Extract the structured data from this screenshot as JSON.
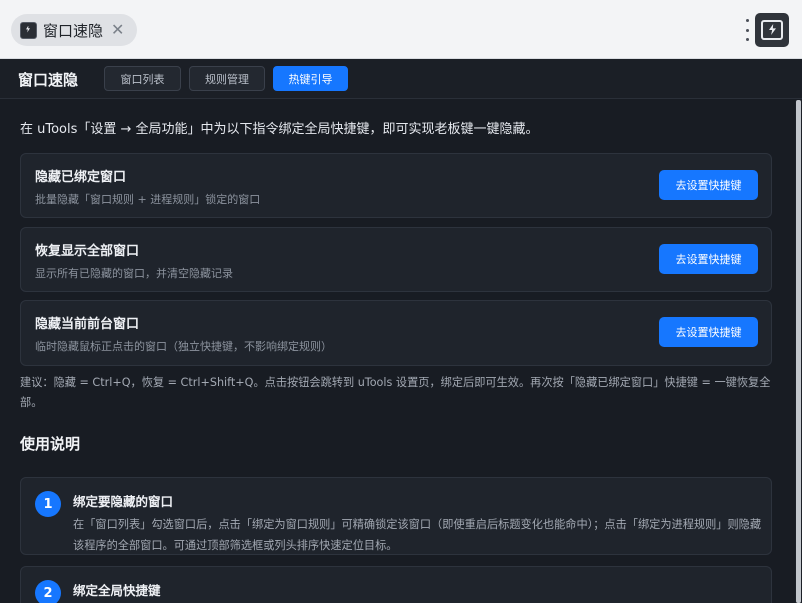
{
  "window": {
    "app_tab_label": "窗口速隐",
    "close_glyph": "✕"
  },
  "header": {
    "brand": "窗口速隐",
    "tabs": [
      {
        "label": "窗口列表",
        "active": false
      },
      {
        "label": "规则管理",
        "active": false
      },
      {
        "label": "热键引导",
        "active": true
      }
    ]
  },
  "main": {
    "intro": "在 uTools「设置 → 全局功能」中为以下指令绑定全局快捷键，即可实现老板键一键隐藏。",
    "commands": [
      {
        "title": "隐藏已绑定窗口",
        "desc": "批量隐藏「窗口规则 + 进程规则」锁定的窗口",
        "button": "去设置快捷键"
      },
      {
        "title": "恢复显示全部窗口",
        "desc": "显示所有已隐藏的窗口，并清空隐藏记录",
        "button": "去设置快捷键"
      },
      {
        "title": "隐藏当前前台窗口",
        "desc": "临时隐藏鼠标正点击的窗口（独立快捷键，不影响绑定规则）",
        "button": "去设置快捷键"
      }
    ],
    "tip": "建议：隐藏 = Ctrl+Q，恢复 = Ctrl+Shift+Q。点击按钮会跳转到 uTools 设置页，绑定后即可生效。再次按「隐藏已绑定窗口」快捷键 = 一键恢复全部。",
    "usage_title": "使用说明",
    "steps": [
      {
        "num": "1",
        "title": "绑定要隐藏的窗口",
        "desc": "在「窗口列表」勾选窗口后，点击「绑定为窗口规则」可精确锁定该窗口（即使重启后标题变化也能命中）；点击「绑定为进程规则」则隐藏该程序的全部窗口。可通过顶部筛选框或列头排序快速定位目标。"
      },
      {
        "num": "2",
        "title": "绑定全局快捷键",
        "desc": ""
      }
    ]
  },
  "colors": {
    "accent": "#1677ff",
    "background": "#181c23",
    "card": "#1f242c",
    "titlebar": "#f3f4f6"
  },
  "icons": {
    "app_tab_icon": "lightning-window-icon",
    "logo": "lightning-window-icon",
    "menu": "more-vertical-icon"
  }
}
